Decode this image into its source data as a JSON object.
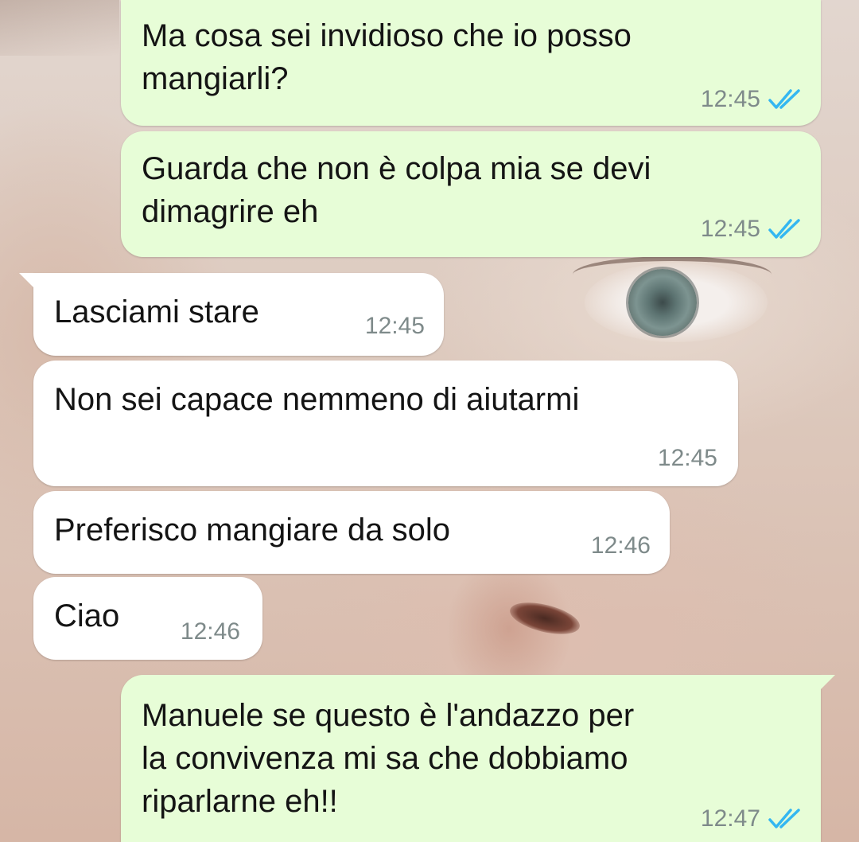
{
  "colors": {
    "outgoing_bubble": "#e7fdd7",
    "incoming_bubble": "#ffffff",
    "timestamp": "#7e8a8a",
    "read_ticks": "#34b7f1"
  },
  "messages": [
    {
      "direction": "outgoing",
      "text": "Ma cosa sei invidioso che io posso\nmangiarli?",
      "time": "12:45",
      "status_icon": "double-check-read-icon"
    },
    {
      "direction": "outgoing",
      "text": "Guarda che non è colpa mia se devi\ndimagrire eh",
      "time": "12:45",
      "status_icon": "double-check-read-icon"
    },
    {
      "direction": "incoming",
      "text": "Lasciami stare",
      "time": "12:45"
    },
    {
      "direction": "incoming",
      "text": "Non sei capace nemmeno di aiutarmi",
      "time": "12:45"
    },
    {
      "direction": "incoming",
      "text": "Preferisco mangiare da solo",
      "time": "12:46"
    },
    {
      "direction": "incoming",
      "text": "Ciao",
      "time": "12:46"
    },
    {
      "direction": "outgoing",
      "text": "Manuele se questo è l'andazzo per\nla convivenza mi sa che dobbiamo\nriparlarne eh!!",
      "time": "12:47",
      "status_icon": "double-check-read-icon"
    }
  ]
}
